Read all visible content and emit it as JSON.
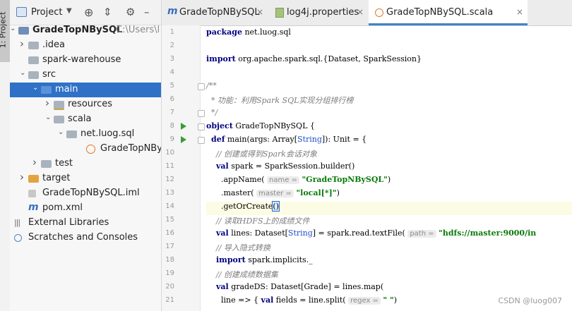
{
  "toolstrip": {
    "project_tab": "1: Project"
  },
  "project_panel": {
    "title": "Project",
    "tree": [
      {
        "label": "GradeTopNBySQL",
        "suffix": "C:\\Users\\l",
        "arrow": "▾",
        "icon": "module-folder-icon",
        "bold": true
      },
      {
        "label": ".idea",
        "arrow": "›",
        "icon": "folder-icon"
      },
      {
        "label": "spark-warehouse",
        "arrow": "",
        "icon": "folder-icon"
      },
      {
        "label": "src",
        "arrow": "▾",
        "icon": "folder-icon"
      },
      {
        "label": "main",
        "arrow": "▾",
        "icon": "source-folder-icon",
        "selected": true
      },
      {
        "label": "resources",
        "arrow": "›",
        "icon": "resources-folder-icon"
      },
      {
        "label": "scala",
        "arrow": "▾",
        "icon": "folder-icon"
      },
      {
        "label": "net.luog.sql",
        "arrow": "▾",
        "icon": "package-icon"
      },
      {
        "label": "GradeTopNBySQL",
        "arrow": "",
        "icon": "scala-object-icon"
      },
      {
        "label": "test",
        "arrow": "›",
        "icon": "folder-icon"
      },
      {
        "label": "target",
        "arrow": "›",
        "icon": "orange-folder-icon"
      },
      {
        "label": "GradeTopNBySQL.iml",
        "arrow": "",
        "icon": "iml-file-icon"
      },
      {
        "label": "pom.xml",
        "arrow": "",
        "icon": "maven-icon"
      },
      {
        "label": "External Libraries",
        "arrow": "›",
        "icon": "libraries-icon"
      },
      {
        "label": "Scratches and Consoles",
        "arrow": "",
        "icon": "scratches-icon"
      }
    ]
  },
  "tabs": [
    {
      "label": "GradeTopNBySQL",
      "icon": "maven-icon",
      "active": false
    },
    {
      "label": "log4j.properties",
      "icon": "properties-file-icon",
      "active": false
    },
    {
      "label": "GradeTopNBySQL.scala",
      "icon": "scala-object-icon",
      "active": true
    }
  ],
  "editor": {
    "line_numbers": [
      "1",
      "2",
      "3",
      "4",
      "5",
      "6",
      "7",
      "8",
      "9",
      "10",
      "11",
      "12",
      "13",
      "14",
      "15",
      "16",
      "17",
      "18",
      "19",
      "20",
      "21"
    ],
    "lines": [
      [
        {
          "t": "package",
          "c": "kw"
        },
        {
          "t": " net.luog.sql"
        }
      ],
      [],
      [
        {
          "t": "import",
          "c": "kw"
        },
        {
          "t": " org.apache.spark.sql.{Dataset, SparkSession}"
        }
      ],
      [],
      [
        {
          "t": "/**",
          "c": "cm"
        }
      ],
      [
        {
          "t": "  * 功能：利用Spark SQL实现分组排行榜",
          "c": "cm"
        }
      ],
      [
        {
          "t": "  */",
          "c": "cm"
        }
      ],
      [
        {
          "t": "object",
          "c": "kw"
        },
        {
          "t": " GradeTopNBySQL {"
        }
      ],
      [
        {
          "t": "  "
        },
        {
          "t": "def",
          "c": "kw"
        },
        {
          "t": " main(args: Array["
        },
        {
          "t": "String",
          "c": "ty"
        },
        {
          "t": "]): Unit = {"
        }
      ],
      [
        {
          "t": "    // 创建或得到Spark会话对象",
          "c": "cm"
        }
      ],
      [
        {
          "t": "    "
        },
        {
          "t": "val",
          "c": "kw"
        },
        {
          "t": " spark = SparkSession.builder()"
        }
      ],
      [
        {
          "t": "      .appName( "
        },
        {
          "t": "name =",
          "c": "hint"
        },
        {
          "t": " "
        },
        {
          "t": "\"GradeTopNBySQL\"",
          "c": "str"
        },
        {
          "t": ")"
        }
      ],
      [
        {
          "t": "      .master( "
        },
        {
          "t": "master =",
          "c": "hint"
        },
        {
          "t": " "
        },
        {
          "t": "\"local[*]\"",
          "c": "str"
        },
        {
          "t": ")"
        }
      ],
      [
        {
          "t": "      .getOrCreate"
        },
        {
          "t": "()",
          "c": "cursor"
        }
      ],
      [
        {
          "t": "    // 读取HDFS上的成绩文件",
          "c": "cm"
        }
      ],
      [
        {
          "t": "    "
        },
        {
          "t": "val",
          "c": "kw"
        },
        {
          "t": " lines: Dataset["
        },
        {
          "t": "String",
          "c": "ty"
        },
        {
          "t": "] = spark.read.textFile( "
        },
        {
          "t": "path =",
          "c": "hint"
        },
        {
          "t": " "
        },
        {
          "t": "\"hdfs://master:9000/in",
          "c": "str"
        }
      ],
      [
        {
          "t": "    // 导入隐式转换",
          "c": "cm"
        }
      ],
      [
        {
          "t": "    "
        },
        {
          "t": "import",
          "c": "kw"
        },
        {
          "t": " spark.implicits._"
        }
      ],
      [
        {
          "t": "    // 创建成绩数据集",
          "c": "cm"
        }
      ],
      [
        {
          "t": "    "
        },
        {
          "t": "val",
          "c": "kw"
        },
        {
          "t": " gradeDS: Dataset[Grade] = lines.map("
        }
      ],
      [
        {
          "t": "      line => { "
        },
        {
          "t": "val",
          "c": "kw"
        },
        {
          "t": " fields = line.split( "
        },
        {
          "t": "regex =",
          "c": "hint"
        },
        {
          "t": " "
        },
        {
          "t": "\" \"",
          "c": "str"
        },
        {
          "t": ")"
        }
      ]
    ],
    "run_lines": [
      8,
      9
    ],
    "fold_lines": [
      5,
      7,
      8,
      9
    ],
    "current_line": 14
  },
  "watermark": "CSDN @luog007",
  "colors": {
    "selection": "#2f71c7",
    "keyword": "#000080",
    "string": "#0a7a0a",
    "comment": "#7c7c7c"
  }
}
